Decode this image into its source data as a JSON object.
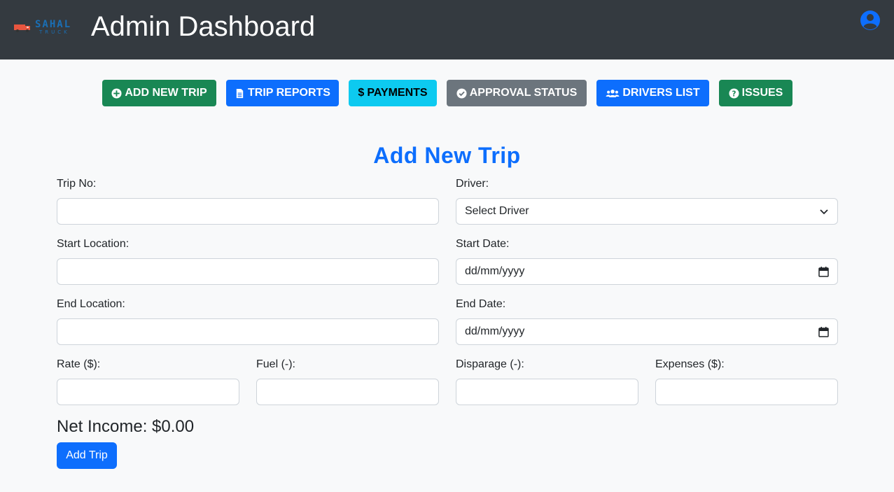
{
  "header": {
    "logo_text": "SAHAL",
    "logo_subtext": "TRUCK",
    "title": "Admin Dashboard",
    "user_icon": "user-circle-icon"
  },
  "nav": {
    "add_new_trip": "ADD NEW TRIP",
    "trip_reports": "TRIP REPORTS",
    "payments": "PAYMENTS",
    "approval_status": "APPROVAL STATUS",
    "drivers_list": "DRIVERS LIST",
    "issues": "ISSUES"
  },
  "form": {
    "title": "Add New Trip",
    "trip_no": {
      "label": "Trip No:",
      "value": ""
    },
    "driver": {
      "label": "Driver:",
      "selected": "Select Driver"
    },
    "start_location": {
      "label": "Start Location:",
      "value": ""
    },
    "start_date": {
      "label": "Start Date:",
      "placeholder": "dd/mm/yyyy"
    },
    "end_location": {
      "label": "End Location:",
      "value": ""
    },
    "end_date": {
      "label": "End Date:",
      "placeholder": "dd/mm/yyyy"
    },
    "rate": {
      "label": "Rate ($):",
      "value": ""
    },
    "fuel": {
      "label": "Fuel (-):",
      "value": ""
    },
    "disparage": {
      "label": "Disparage (-):",
      "value": ""
    },
    "expenses": {
      "label": "Expenses ($):",
      "value": ""
    },
    "net_income": "Net Income: $0.00",
    "submit_label": "Add Trip"
  },
  "colors": {
    "topbar": "#343a40",
    "primary": "#0d6efd",
    "success": "#198754",
    "info": "#0dcaf0",
    "secondary": "#6c757d"
  }
}
